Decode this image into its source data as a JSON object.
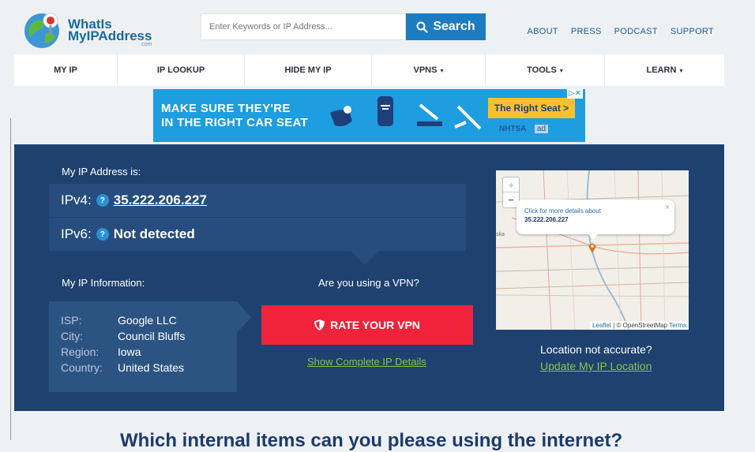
{
  "logo": {
    "line1": "WhatIs",
    "line2": "MyIPAddress",
    "tld": ".com"
  },
  "search": {
    "placeholder": "Enter Keywords or IP Address...",
    "button_label": "Search"
  },
  "top_links": [
    "ABOUT",
    "PRESS",
    "PODCAST",
    "SUPPORT"
  ],
  "nav": [
    {
      "label": "MY IP",
      "caret": ""
    },
    {
      "label": "IP LOOKUP",
      "caret": ""
    },
    {
      "label": "HIDE MY IP",
      "caret": ""
    },
    {
      "label": "VPNS",
      "caret": "▾"
    },
    {
      "label": "TOOLS",
      "caret": "▾"
    },
    {
      "label": "LEARN",
      "caret": "▾"
    }
  ],
  "ad": {
    "line1": "MAKE SURE THEY'RE",
    "line2": "IN THE RIGHT CAR SEAT",
    "cta": "The Right Seat >",
    "sponsor": "NHTSA",
    "badge": "ad",
    "close": "▷✕",
    "bg_color": "#1e9de0"
  },
  "main": {
    "my_ip_label": "My IP Address is:",
    "ipv4_label": "IPv4:",
    "ipv4_value": "35.222.206.227",
    "ipv6_label": "IPv6:",
    "ipv6_value": "Not detected",
    "help_glyph": "?",
    "info_label": "My IP Information:",
    "info": [
      {
        "key": "ISP:",
        "value": "Google LLC"
      },
      {
        "key": "City:",
        "value": "Council Bluffs"
      },
      {
        "key": "Region:",
        "value": "Iowa"
      },
      {
        "key": "Country:",
        "value": "United States"
      }
    ],
    "vpn_question": "Are you using a VPN?",
    "rate_vpn_label": "RATE YOUR VPN",
    "details_link": "Show Complete IP Details",
    "location_question": "Location not accurate?",
    "update_location_link": "Update My IP Location",
    "panel_color": "#1e4170"
  },
  "map": {
    "zoom_in": "+",
    "zoom_out": "−",
    "popup_line1": "Click for more details about",
    "popup_line2": "35.222.206.227",
    "popup_close": "×",
    "state_label": "ska",
    "attribution_leaflet": "Leaflet",
    "attribution_mid": " | © OpenStreetMap ",
    "attribution_terms": "Terms"
  },
  "partial_heading": "Which internal items can you please using the internet?"
}
